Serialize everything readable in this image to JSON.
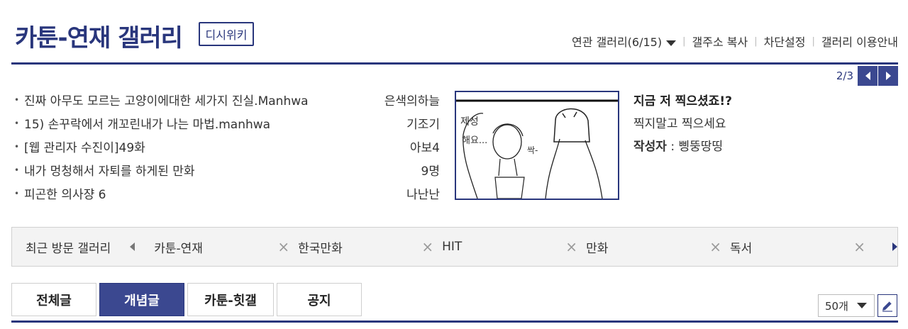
{
  "header": {
    "title": "카툰-연재 갤러리",
    "wiki_label": "디시위키",
    "links": {
      "related": "연관 갤러리(6/15)",
      "copy_address": "갤주소 복사",
      "block_settings": "차단설정",
      "guide": "갤러리 이용안내"
    },
    "accent_color": "#29367c"
  },
  "pager": {
    "text": "2/3"
  },
  "concept_posts": [
    {
      "title": "진짜 아무도 모르는 고양이에대한 세가지 진실.Manhwa",
      "author": "은색의하늘"
    },
    {
      "title": "15) 손꾸락에서 개꼬린내가 나는 마법.manhwa",
      "author": "기조기"
    },
    {
      "title": "[웹 관리자 수진이]49화",
      "author": "아보4"
    },
    {
      "title": "내가 멍청해서 자퇴를 하게된 만화",
      "author": "9명"
    },
    {
      "title": "피곤한 의사쟝 6",
      "author": "나난난"
    }
  ],
  "featured": {
    "title": "지금 저 찍으셨죠!?",
    "subtitle": "찍지말고 찍으세요",
    "author_label": "작성자",
    "author_sep": " : ",
    "author": "삥뚱땅띵",
    "thumb_text_1": "제성",
    "thumb_text_2": "해요...",
    "thumb_text_3": "싹-"
  },
  "recent": {
    "label": "최근 방문 갤러리",
    "items": [
      {
        "name": "카툰-연재"
      },
      {
        "name": "한국만화"
      },
      {
        "name": "HIT"
      },
      {
        "name": "만화"
      },
      {
        "name": "독서"
      }
    ],
    "remove_glyph": "×"
  },
  "tabs": [
    {
      "label": "전체글",
      "active": false
    },
    {
      "label": "개념글",
      "active": true
    },
    {
      "label": "카툰-힛갤",
      "active": false
    },
    {
      "label": "공지",
      "active": false
    }
  ],
  "per_page": "50개",
  "icons": [
    "caret-down-icon",
    "arrow-left-icon",
    "arrow-right-icon",
    "close-icon",
    "pencil-icon"
  ]
}
